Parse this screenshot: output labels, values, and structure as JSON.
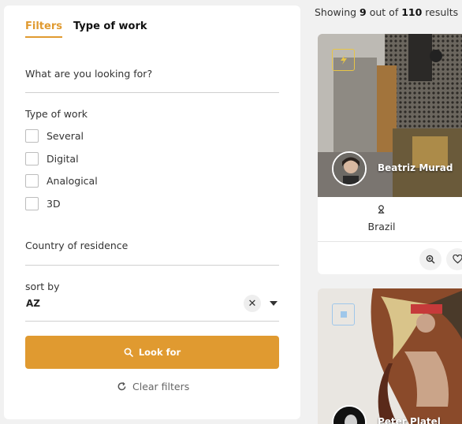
{
  "filters": {
    "tabs": [
      {
        "label": "Filters"
      },
      {
        "label": "Type of work"
      }
    ],
    "search": {
      "placeholder": "What are you looking for?"
    },
    "type_of_work": {
      "label": "Type of work",
      "options": [
        {
          "label": "Several"
        },
        {
          "label": "Digital"
        },
        {
          "label": "Analogical"
        },
        {
          "label": "3D"
        }
      ]
    },
    "country": {
      "label": "Country of residence"
    },
    "sort": {
      "label": "sort by",
      "value": "AZ"
    },
    "look_button": "Look for",
    "clear_filters": "Clear filters"
  },
  "results": {
    "prefix": "Showing",
    "shown": "9",
    "middle": "out of",
    "total": "110",
    "suffix": "results"
  },
  "cards": [
    {
      "artist": "Beatriz Murad",
      "country": "Brazil",
      "type_icon": "lightning-icon"
    },
    {
      "artist": "Peter Platel",
      "type_icon": "cube-icon"
    }
  ],
  "colors": {
    "accent": "#e09a30",
    "badge_yellow": "#e8c547",
    "badge_blue": "#9fc7ea"
  }
}
